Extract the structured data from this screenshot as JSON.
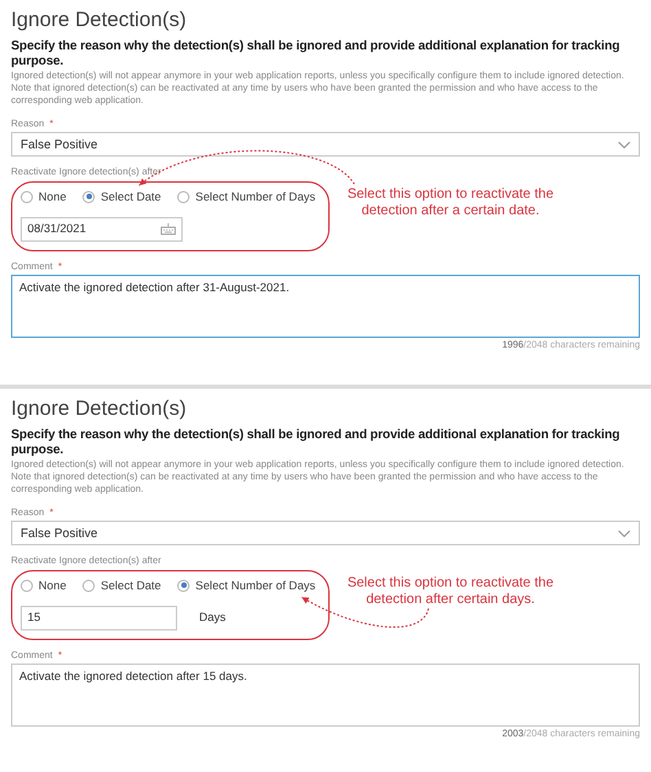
{
  "panels": [
    {
      "title": "Ignore Detection(s)",
      "heading": "Specify the reason why the detection(s) shall be ignored and provide additional explanation for tracking purpose.",
      "description": [
        "Ignored detection(s) will not appear anymore in your web application reports, unless you specifically configure them to include ignored detection.",
        "Note that ignored detection(s) can be reactivated at any time by users who have been granted the permission and who have access to the corresponding web application."
      ],
      "reason": {
        "label": "Reason",
        "required_mark": "*",
        "value": "False Positive"
      },
      "reactivate": {
        "label": "Reactivate Ignore detection(s) after",
        "options": [
          {
            "label": "None",
            "selected": false
          },
          {
            "label": "Select Date",
            "selected": true
          },
          {
            "label": "Select Number of Days",
            "selected": false
          }
        ],
        "input": {
          "kind": "date",
          "value": "08/31/2021"
        }
      },
      "comment": {
        "label": "Comment",
        "required_mark": "*",
        "value": "Activate the ignored detection after 31-August-2021.",
        "focused": true
      },
      "counter": {
        "used": "1996",
        "rest": "/2048 characters remaining"
      },
      "callout": "Select this option to reactivate the detection after a certain date."
    },
    {
      "title": "Ignore Detection(s)",
      "heading": "Specify the reason why the detection(s) shall be ignored and provide additional explanation for tracking purpose.",
      "description": [
        "Ignored detection(s) will not appear anymore in your web application reports, unless you specifically configure them to include ignored detection.",
        "Note that ignored detection(s) can be reactivated at any time by users who have been granted the permission and who have access to the corresponding web application."
      ],
      "reason": {
        "label": "Reason",
        "required_mark": "*",
        "value": "False Positive"
      },
      "reactivate": {
        "label": "Reactivate Ignore detection(s) after",
        "options": [
          {
            "label": "None",
            "selected": false
          },
          {
            "label": "Select Date",
            "selected": false
          },
          {
            "label": "Select Number of Days",
            "selected": true
          }
        ],
        "input": {
          "kind": "days",
          "value": "15",
          "unit": "Days"
        }
      },
      "comment": {
        "label": "Comment",
        "required_mark": "*",
        "value": "Activate the ignored detection after 15 days.",
        "focused": false
      },
      "counter": {
        "used": "2003",
        "rest": "/2048 characters remaining"
      },
      "callout": "Select this option to reactivate the detection after certain days."
    }
  ]
}
